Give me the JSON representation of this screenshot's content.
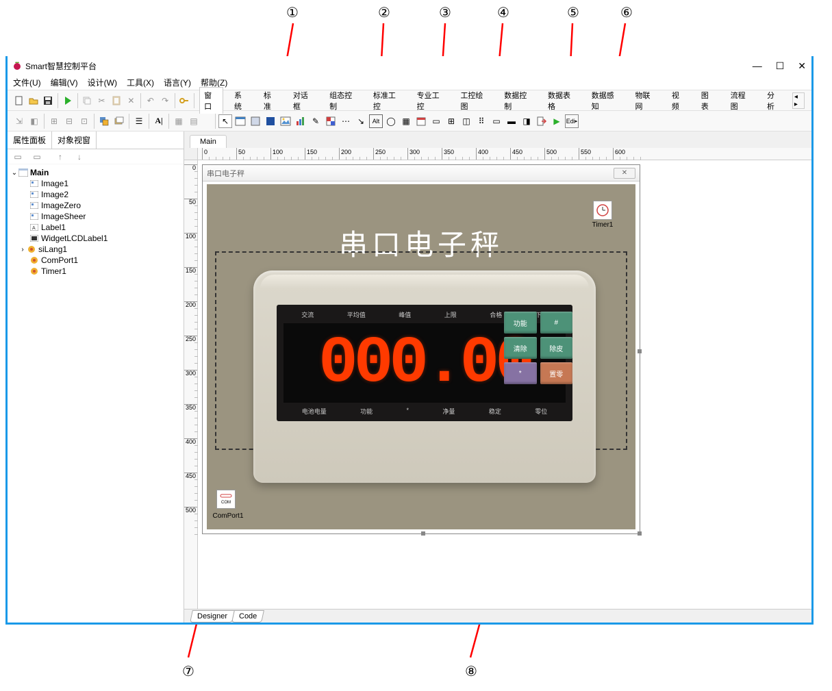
{
  "callouts": [
    "①",
    "②",
    "③",
    "④",
    "⑤",
    "⑥",
    "⑦",
    "⑧"
  ],
  "window": {
    "title": "Smart智慧控制平台",
    "controls": {
      "min": "—",
      "max": "☐",
      "close": "✕"
    }
  },
  "menubar": [
    "文件(U)",
    "编辑(V)",
    "设计(W)",
    "工具(X)",
    "语言(Y)",
    "帮助(Z)"
  ],
  "component_tabs": [
    "窗口",
    "系统",
    "标准",
    "对话框",
    "组态控制",
    "标准工控",
    "专业工控",
    "工控绘图",
    "数据控制",
    "数据表格",
    "数据感知",
    "物联网",
    "视频",
    "图表",
    "流程图",
    "分析"
  ],
  "left_panel": {
    "tabs": [
      "属性面板",
      "对象视窗"
    ],
    "tree": {
      "root": "Main",
      "children": [
        "Image1",
        "Image2",
        "ImageZero",
        "ImageSheer",
        "Label1",
        "WidgetLCDLabel1",
        "siLang1",
        "ComPort1",
        "Timer1"
      ]
    }
  },
  "design": {
    "tab": "Main",
    "window_title": "串口电子秤",
    "title_text": "串口电子秤",
    "lcd_value": "000.00",
    "indicators_top": [
      "交流",
      "平均值",
      "峰值",
      "上限",
      "合格",
      "下限"
    ],
    "indicators_bottom": [
      "电池电量",
      "功能",
      "*",
      "净量",
      "稳定",
      "零位"
    ],
    "buttons": [
      {
        "label": "功能",
        "color": "green"
      },
      {
        "label": "#",
        "color": "green"
      },
      {
        "label": "清除",
        "color": "green"
      },
      {
        "label": "除皮",
        "color": "green"
      },
      {
        "label": "*",
        "color": "purple"
      },
      {
        "label": "置零",
        "color": "orange"
      }
    ],
    "timer_label": "Timer1",
    "comport_label": "ComPort1",
    "comport_icon": "COM",
    "ruler_h": [
      "0",
      "50",
      "100",
      "150",
      "200",
      "250",
      "300",
      "350",
      "400",
      "450",
      "500",
      "550",
      "600"
    ],
    "ruler_v": [
      "0",
      "50",
      "100",
      "150",
      "200",
      "250",
      "300",
      "350",
      "400",
      "450",
      "500"
    ]
  },
  "bottom_tabs": [
    "Designer",
    "Code"
  ]
}
